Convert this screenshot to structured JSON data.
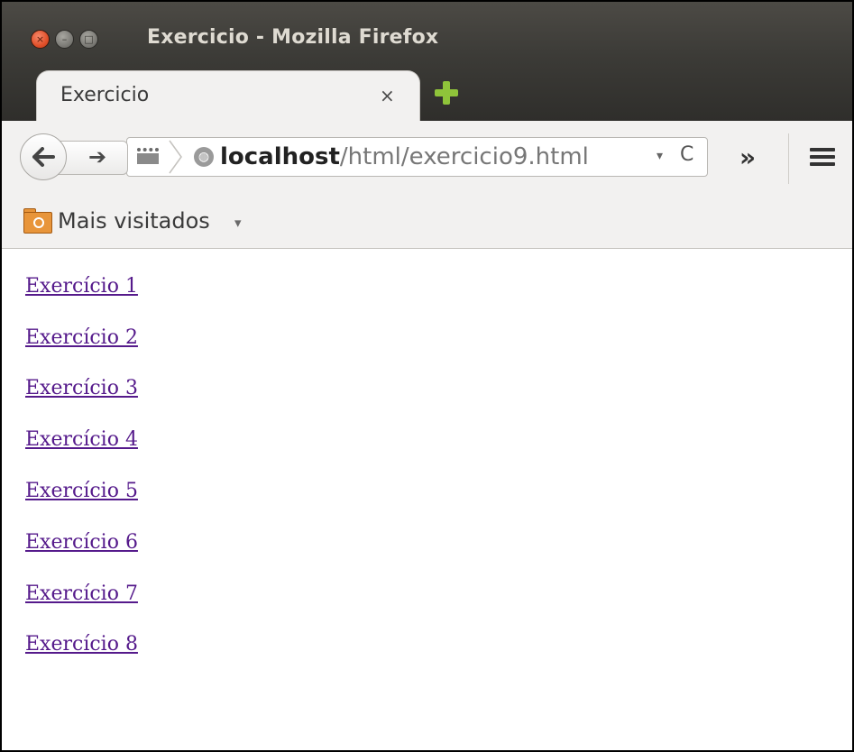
{
  "window": {
    "title": "Exercicio - Mozilla Firefox",
    "close_glyph": "×",
    "minimize_glyph": "–",
    "maximize_glyph": "□"
  },
  "tab": {
    "label": "Exercicio",
    "close_glyph": "×"
  },
  "navbar": {
    "url_host": "localhost",
    "url_path": "/html/exercicio9.html",
    "back_glyph": "🡐",
    "forward_glyph": "➔",
    "globe_glyph": "◍",
    "dropdown_glyph": "▾",
    "reload_glyph": "C",
    "overflow_glyph": "»"
  },
  "bookmarks": {
    "label": "Mais visitados",
    "arrow_glyph": "▾"
  },
  "links": [
    "Exercício 1",
    "Exercício 2",
    "Exercício 3",
    "Exercício 4",
    "Exercício 5",
    "Exercício 6",
    "Exercício 7",
    "Exercício 8"
  ],
  "colors": {
    "visited_link": "#551a8b",
    "titlebar": "#3c3b37",
    "toolbar": "#f2f1f0",
    "close_button": "#e0502a",
    "new_tab_plus": "#8fc43a"
  },
  "icons": {
    "new_tab": "new-tab-plus-icon",
    "menu": "hamburger-menu-icon",
    "bookmark_folder": "smart-bookmarks-folder-icon",
    "identity": "page-info-icon"
  }
}
